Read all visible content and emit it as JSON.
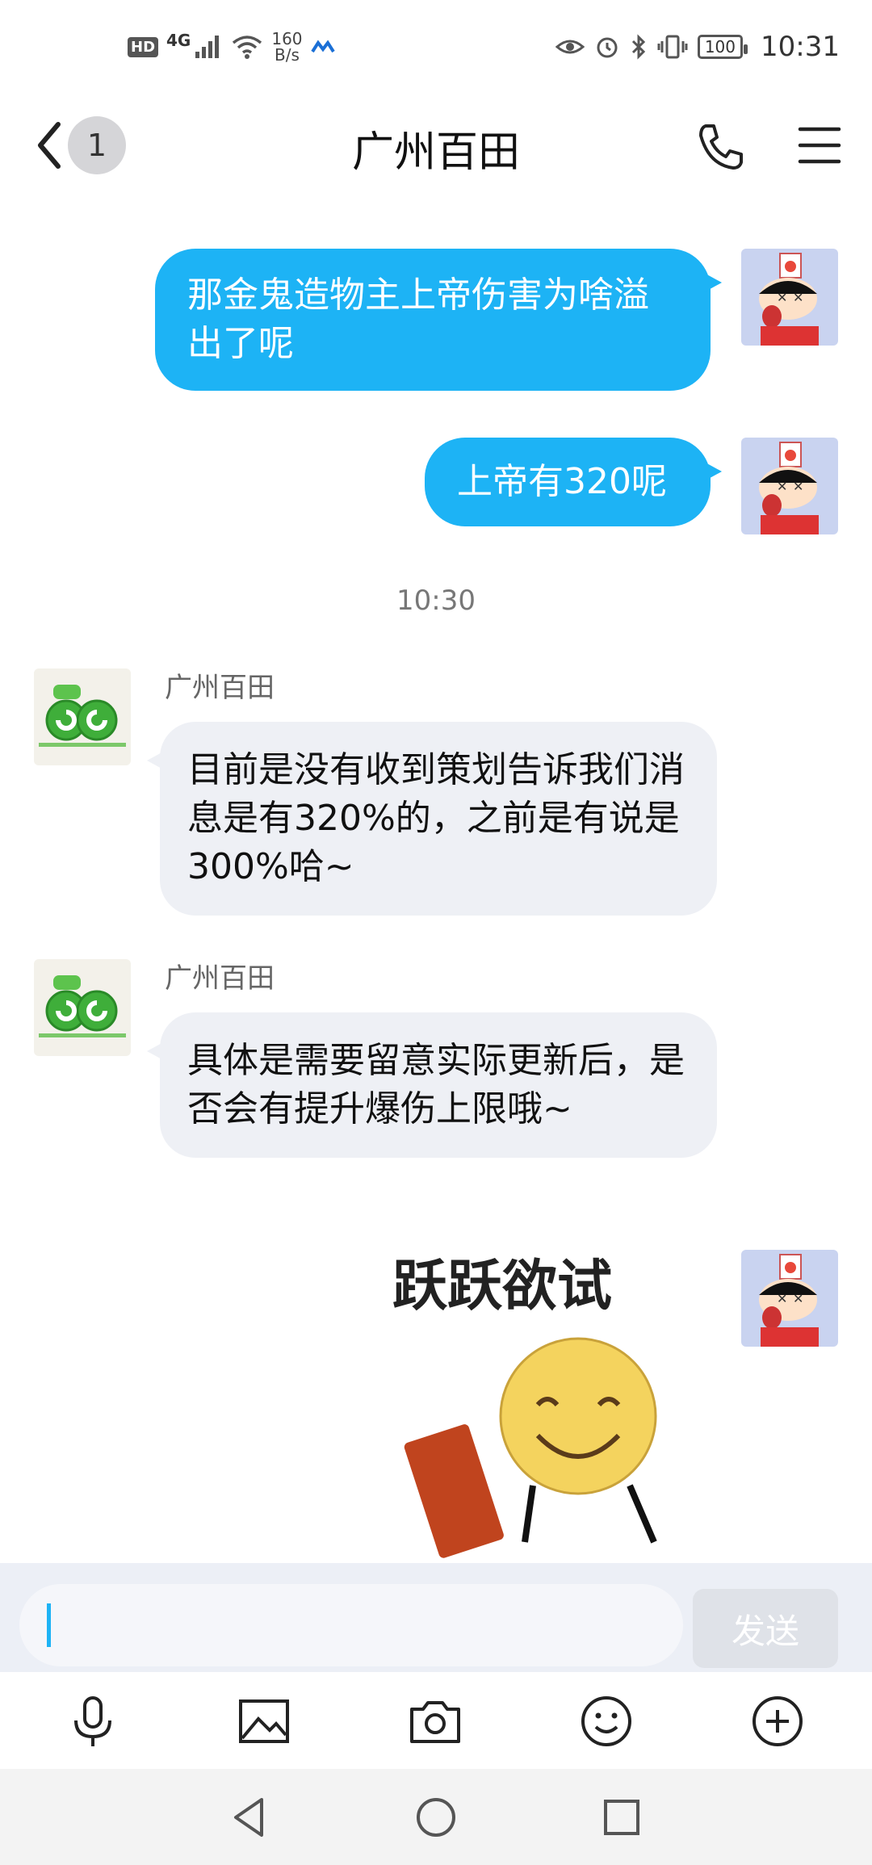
{
  "status_bar": {
    "hd": "HD",
    "net_type": "4G",
    "speed_value": "160",
    "speed_unit": "B/s",
    "battery": "100",
    "time": "10:31"
  },
  "header": {
    "unread_count": "1",
    "title": "广州百田"
  },
  "messages": {
    "out_1": "那金鬼造物主上帝伤害为啥溢出了呢",
    "out_2": "上帝有320呢",
    "timestamp": "10:30",
    "in_1_sender": "广州百田",
    "in_1": "目前是没有收到策划告诉我们消息是有320%的，之前是有说是300%哈~",
    "in_2_sender": "广州百田",
    "in_2": "具体是需要留意实际更新后，是否会有提升爆伤上限哦~",
    "sticker_text": "跃跃欲试"
  },
  "input": {
    "value": "",
    "send_label": "发送"
  },
  "toolbar": {
    "icons": [
      "microphone-icon",
      "image-icon",
      "camera-icon",
      "emoji-icon",
      "plus-icon"
    ]
  },
  "colors": {
    "outgoing_bubble": "#1db3f5",
    "incoming_bubble": "#eef0f5",
    "input_bar": "#eceff6"
  }
}
